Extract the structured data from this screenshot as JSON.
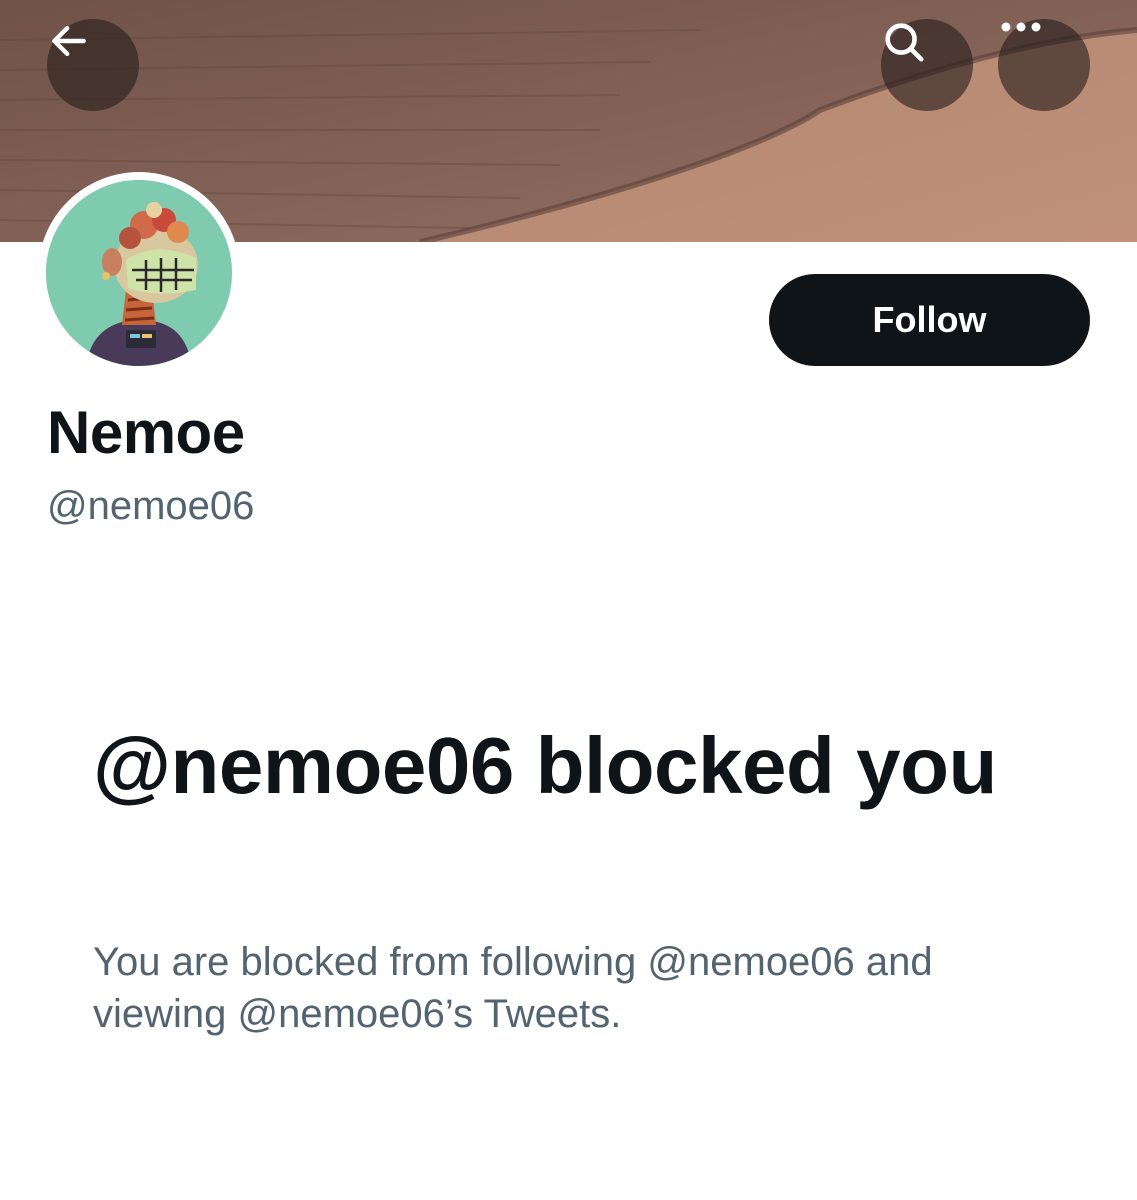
{
  "header": {
    "back_icon": "arrow-left-icon",
    "search_icon": "search-icon",
    "more_icon": "more-horizontal-icon"
  },
  "profile": {
    "display_name": "Nemoe",
    "handle": "@nemoe06",
    "follow_label": "Follow"
  },
  "blocked": {
    "title": "@nemoe06 blocked you",
    "description": "You are blocked from following @nemoe06 and viewing @nemoe06’s Tweets."
  },
  "colors": {
    "text_primary": "#0f1419",
    "text_secondary": "#536471",
    "button_dark": "#0f1419",
    "avatar_bg": "#7fcbb0"
  }
}
